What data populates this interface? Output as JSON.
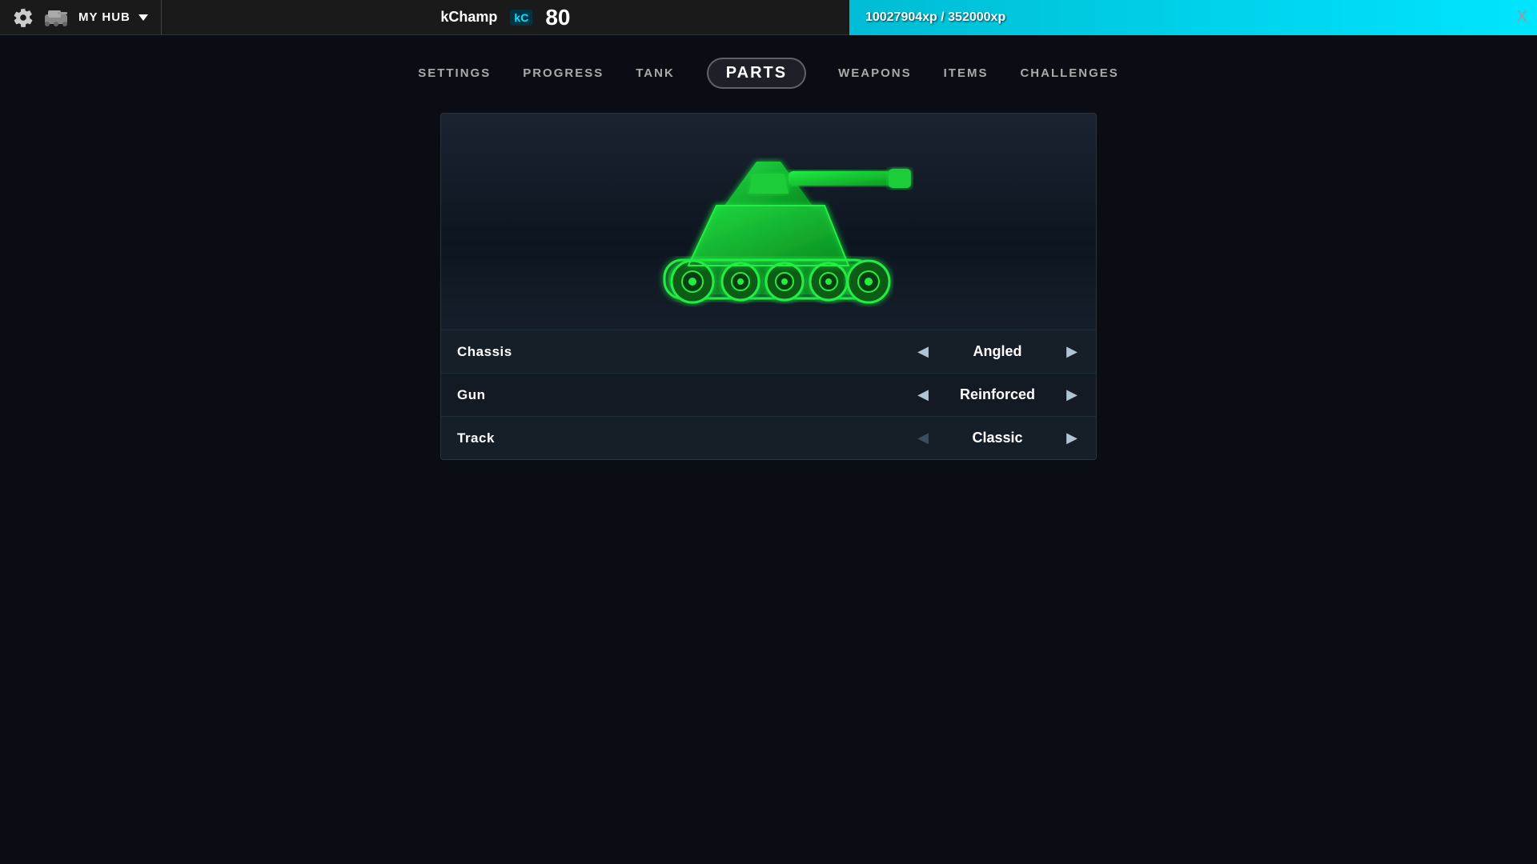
{
  "topbar": {
    "hub_label": "MY HUB",
    "username": "kChamp",
    "kc_badge": "kC",
    "level": "80",
    "xp_current": "10027904xp",
    "xp_total": "352000xp",
    "xp_display": "10027904xp / 352000xp",
    "xp_fill_percent": 85,
    "close_label": "X"
  },
  "nav": {
    "items": [
      {
        "id": "settings",
        "label": "SETTINGS",
        "active": false
      },
      {
        "id": "progress",
        "label": "PROGRESS",
        "active": false
      },
      {
        "id": "tank",
        "label": "TANK",
        "active": false
      },
      {
        "id": "parts",
        "label": "PARTS",
        "active": true
      },
      {
        "id": "weapons",
        "label": "WEAPONS",
        "active": false
      },
      {
        "id": "items",
        "label": "ITEMS",
        "active": false
      },
      {
        "id": "challenges",
        "label": "CHALLENGES",
        "active": false
      }
    ]
  },
  "parts": {
    "rows": [
      {
        "id": "chassis",
        "label": "Chassis",
        "value": "Angled",
        "left_active": true,
        "right_active": true
      },
      {
        "id": "gun",
        "label": "Gun",
        "value": "Reinforced",
        "left_active": true,
        "right_active": true
      },
      {
        "id": "track",
        "label": "Track",
        "value": "Classic",
        "left_active": false,
        "right_active": true
      }
    ]
  }
}
